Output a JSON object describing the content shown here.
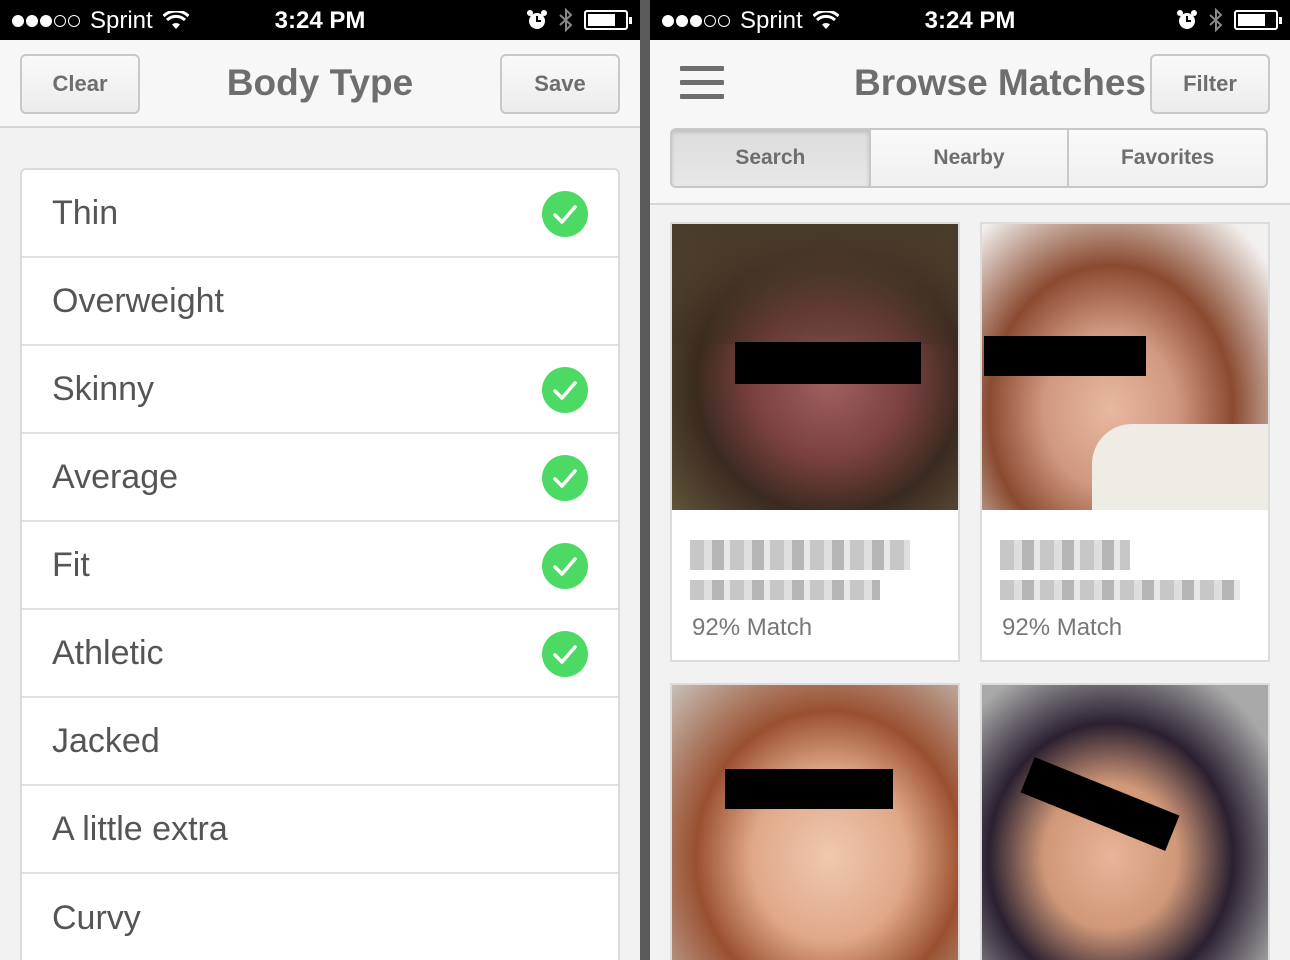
{
  "status_bar": {
    "carrier": "Sprint",
    "time": "3:24 PM",
    "signal_bars_filled": 3,
    "signal_bars_total": 5,
    "battery_level": 0.75
  },
  "body_type_screen": {
    "title": "Body Type",
    "clear_label": "Clear",
    "save_label": "Save",
    "check_color": "#4cd964",
    "options": [
      {
        "label": "Thin",
        "checked": true
      },
      {
        "label": "Overweight",
        "checked": false
      },
      {
        "label": "Skinny",
        "checked": true
      },
      {
        "label": "Average",
        "checked": true
      },
      {
        "label": "Fit",
        "checked": true
      },
      {
        "label": "Athletic",
        "checked": true
      },
      {
        "label": "Jacked",
        "checked": false
      },
      {
        "label": "A little extra",
        "checked": false
      },
      {
        "label": "Curvy",
        "checked": false
      }
    ]
  },
  "browse_screen": {
    "title": "Browse Matches",
    "filter_label": "Filter",
    "tabs": [
      {
        "label": "Search",
        "active": true
      },
      {
        "label": "Nearby",
        "active": false
      },
      {
        "label": "Favorites",
        "active": false
      }
    ],
    "matches": [
      {
        "match_text": "92% Match"
      },
      {
        "match_text": "92% Match"
      },
      {
        "match_text": ""
      },
      {
        "match_text": ""
      }
    ]
  }
}
